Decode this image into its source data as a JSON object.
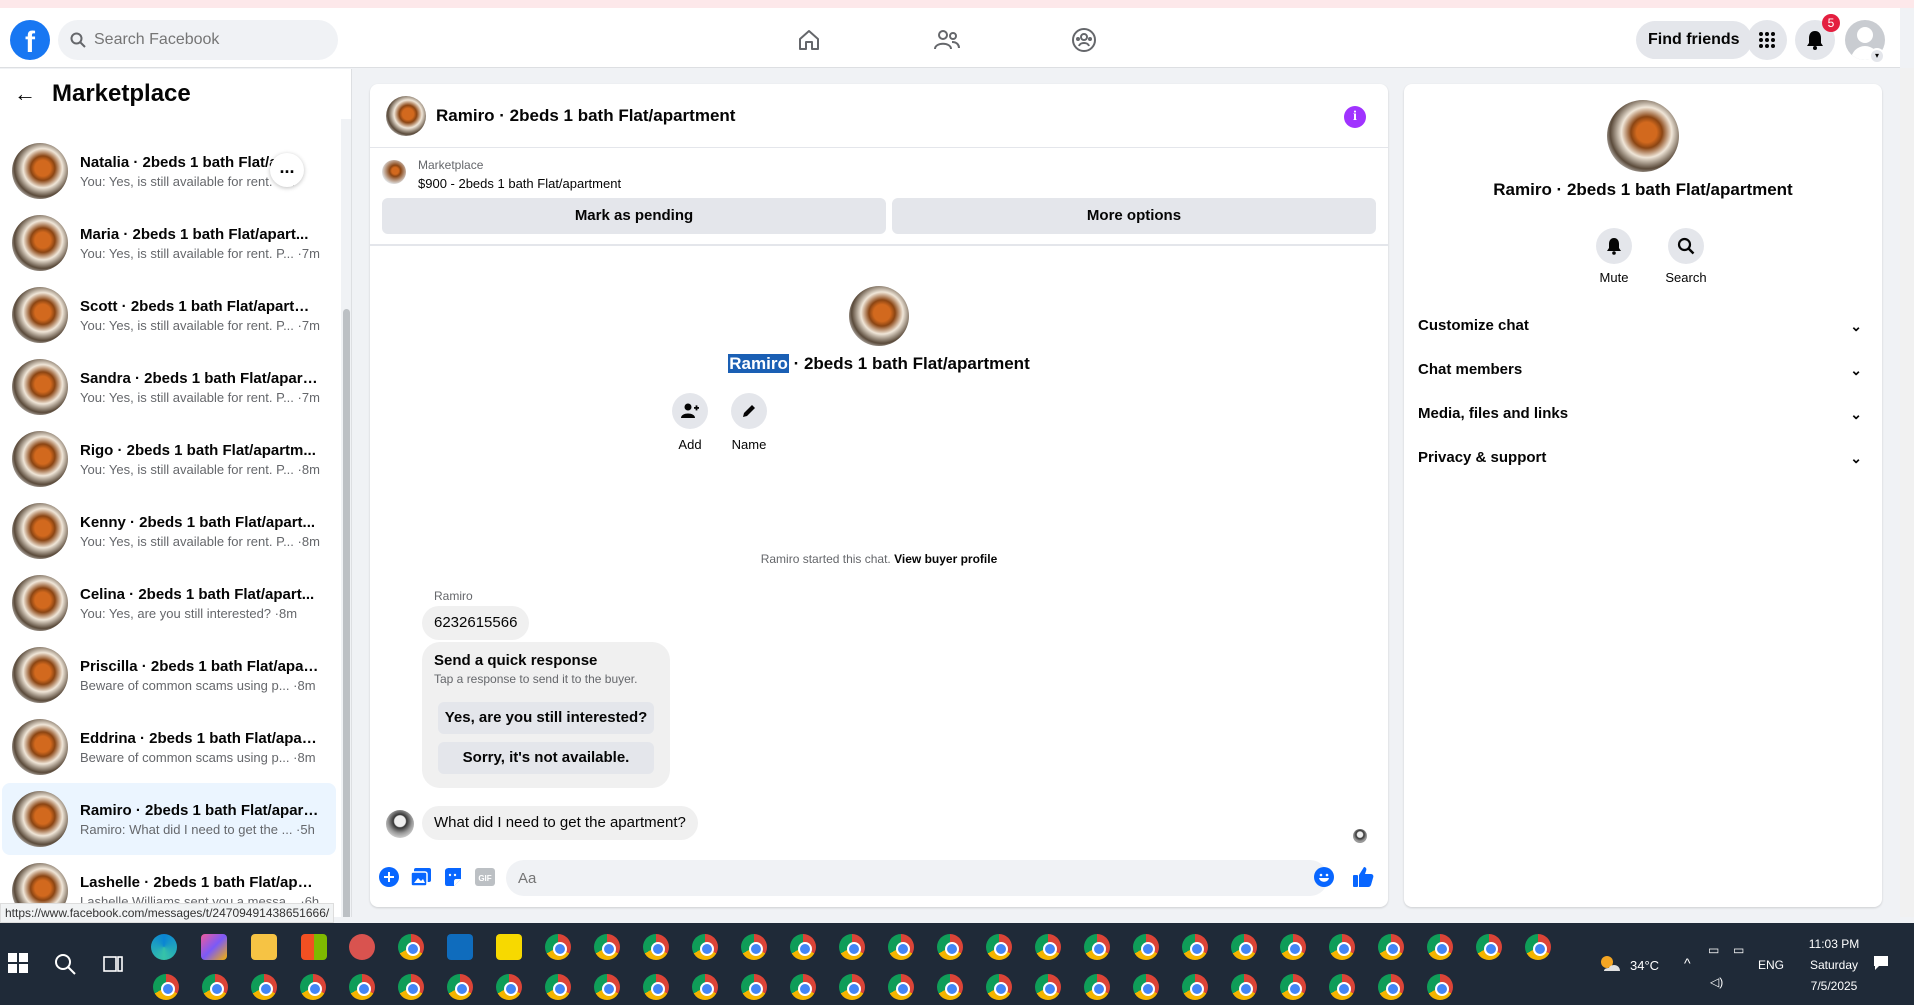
{
  "browser": {
    "status_url": "https://www.facebook.com/messages/t/24709491438651666/"
  },
  "topbar": {
    "logo_letter": "f",
    "search_placeholder": "Search Facebook",
    "find_friends_label": "Find friends",
    "notification_count": "5",
    "nav_icons": [
      "home-icon",
      "friends-icon",
      "groups-icon"
    ],
    "colors": {
      "brand": "#1877f2",
      "badge": "#e41e3f"
    }
  },
  "sidebar": {
    "title": "Marketplace",
    "conversations": [
      {
        "title": "Natalia · 2beds 1 bath Flat/ap",
        "preview": "You: Yes, is still available for rent. · m",
        "time": ""
      },
      {
        "title": "Maria · 2beds 1 bath Flat/apart...",
        "preview": "You: Yes, is still available for rent. P... ·7m",
        "time": ""
      },
      {
        "title": "Scott · 2beds 1 bath Flat/apartm...",
        "preview": "You: Yes, is still available for rent. P... ·7m",
        "time": ""
      },
      {
        "title": "Sandra · 2beds 1 bath Flat/apart...",
        "preview": "You: Yes, is still available for rent. P... ·7m",
        "time": ""
      },
      {
        "title": "Rigo · 2beds 1 bath Flat/apartm...",
        "preview": "You: Yes, is still available for rent. P... ·8m",
        "time": ""
      },
      {
        "title": "Kenny · 2beds 1 bath Flat/apart...",
        "preview": "You: Yes, is still available for rent. P... ·8m",
        "time": ""
      },
      {
        "title": "Celina · 2beds 1 bath Flat/apart...",
        "preview": "You: Yes, are you still interested? ·8m",
        "time": ""
      },
      {
        "title": "Priscilla · 2beds 1 bath Flat/apart...",
        "preview": "Beware of common scams using p... ·8m",
        "time": ""
      },
      {
        "title": "Eddrina · 2beds 1 bath Flat/apart...",
        "preview": "Beware of common scams using p... ·8m",
        "time": ""
      },
      {
        "title": "Ramiro · 2beds 1 bath Flat/apart...",
        "preview": "Ramiro: What did I need to get the ... ·5h",
        "time": ""
      },
      {
        "title": "Lashelle · 2beds 1 bath Flat/apar...",
        "preview": "Lashelle Williams sent you a messa... ·6h",
        "time": ""
      }
    ],
    "more_label": "..."
  },
  "chat": {
    "header_title": "Ramiro · 2beds 1 bath Flat/apartment",
    "listing_source": "Marketplace",
    "listing_price": "$900 - 2beds 1 bath Flat/apartment",
    "mark_pending_label": "Mark as pending",
    "more_options_label": "More options",
    "intro_name_highlight": "Ramiro",
    "intro_name_rest": " · 2beds 1 bath Flat/apartment",
    "add_label": "Add",
    "name_label": "Name",
    "started_text": "Ramiro started this chat.",
    "view_buyer_label": "View buyer profile",
    "sender_name": "Ramiro",
    "msg_phone": "6232615566",
    "quick_title": "Send a quick response",
    "quick_sub": "Tap a response to send it to the buyer.",
    "quick_opt_1": "Yes, are you still interested?",
    "quick_opt_2": "Sorry, it's not available.",
    "msg_last": "What did I need to get the apartment?",
    "composer_placeholder": "Aa"
  },
  "rpanel": {
    "name": "Ramiro · 2beds 1 bath Flat/apartment",
    "mute_label": "Mute",
    "search_label": "Search",
    "sections": [
      "Customize chat",
      "Chat members",
      "Media, files and links",
      "Privacy & support"
    ]
  },
  "taskbar": {
    "temperature": "34°C",
    "language": "ENG",
    "time": "11:03 PM",
    "day": "Saturday",
    "date": "7/5/2025"
  }
}
